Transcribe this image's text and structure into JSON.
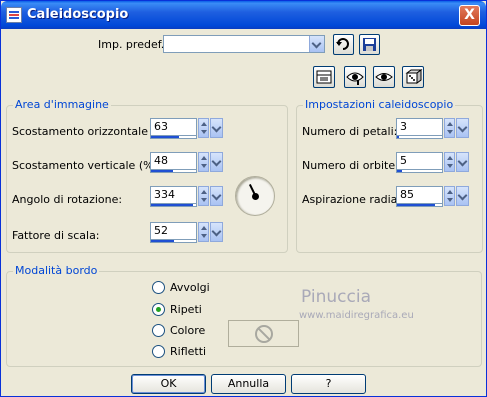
{
  "window": {
    "title": "Caleidoscopio",
    "close_label": "X"
  },
  "preset": {
    "label": "Imp. predef.:",
    "value": ""
  },
  "icons": {
    "reset": "reset-icon",
    "save": "save-icon",
    "toolbar": [
      "dialog-layout-icon",
      "eye-preview-icon",
      "eye-proof-icon",
      "dice-randomize-icon"
    ]
  },
  "image_area": {
    "title": "Area d'immagine",
    "fields": [
      {
        "label": "Scostamento orizzontale (%):",
        "value": "63",
        "fill": 0.63
      },
      {
        "label": "Scostamento verticale (%):",
        "value": "48",
        "fill": 0.48
      },
      {
        "label": "Angolo di rotazione:",
        "value": "334",
        "fill": 0.93
      },
      {
        "label": "Fattore di scala:",
        "value": "52",
        "fill": 0.52
      }
    ]
  },
  "kaleido_settings": {
    "title": "Impostazioni caleidoscopio",
    "fields": [
      {
        "label": "Numero di petali:",
        "value": "3",
        "fill": 0.05
      },
      {
        "label": "Numero di orbite:",
        "value": "5",
        "fill": 0.1
      },
      {
        "label": "Aspirazione radiale:",
        "value": "85",
        "fill": 0.85
      }
    ]
  },
  "border_mode": {
    "title": "Modalità bordo",
    "options": [
      "Avvolgi",
      "Ripeti",
      "Colore",
      "Rifletti"
    ],
    "selected": "Ripeti"
  },
  "watermark": {
    "name": "Pinuccia",
    "url": "www.maidiregrafica.eu"
  },
  "buttons": {
    "ok": "OK",
    "cancel": "Annulla",
    "help": "?"
  },
  "colors": {
    "accent": "#0046d5",
    "title_bar": "#0058e6",
    "face": "#ece9d8"
  }
}
